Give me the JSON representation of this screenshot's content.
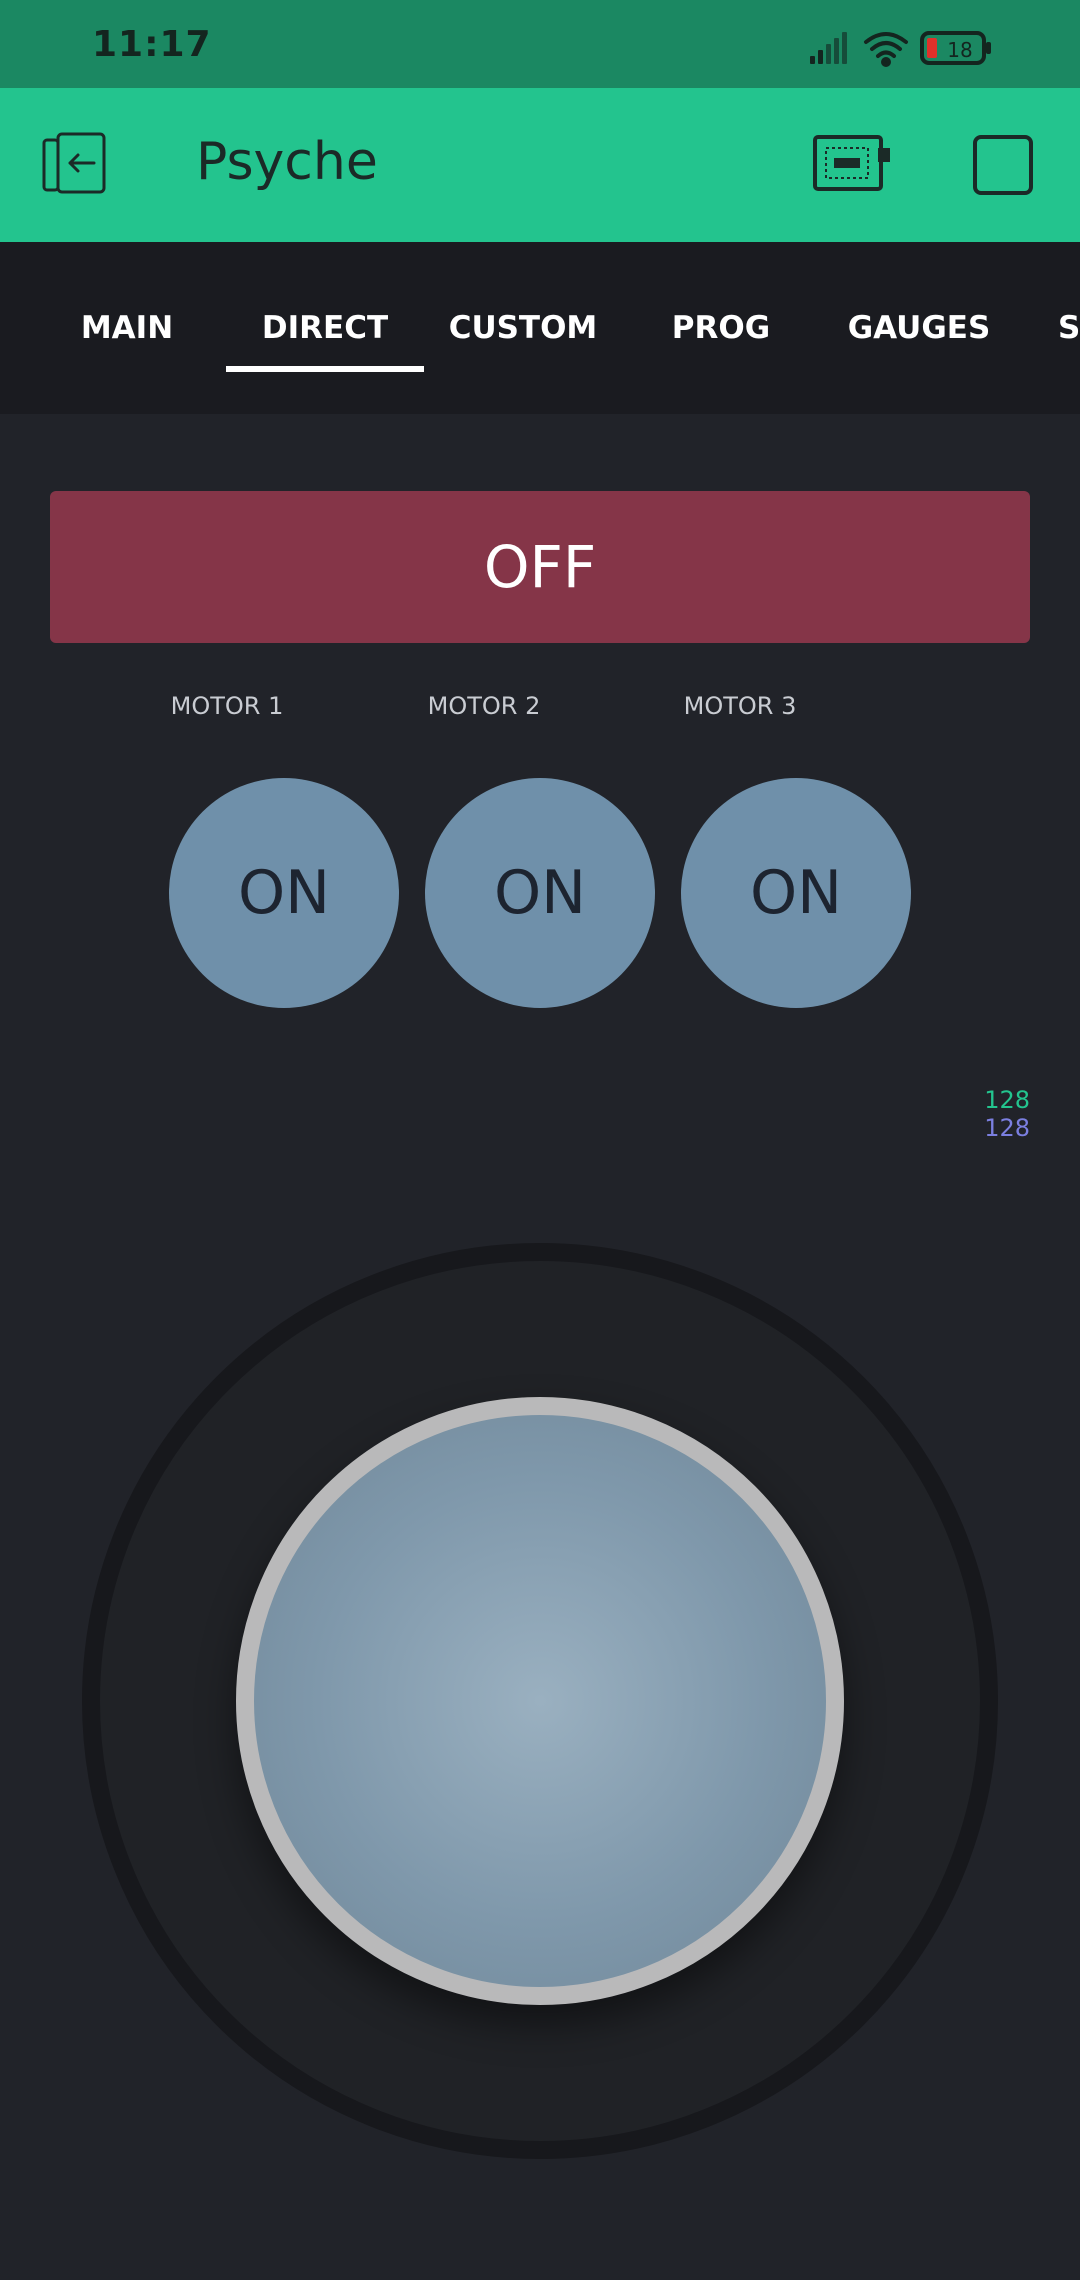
{
  "status_bar": {
    "time": "11:17",
    "battery": "18",
    "icons": [
      "signal-icon",
      "wifi-icon",
      "battery-icon"
    ]
  },
  "app_bar": {
    "title": "Psyche",
    "icons": [
      "exit-icon",
      "device-icon",
      "stop-icon"
    ]
  },
  "tabs": [
    {
      "label": "MAIN"
    },
    {
      "label": "DIRECT",
      "selected": true
    },
    {
      "label": "CUSTOM"
    },
    {
      "label": "PROG"
    },
    {
      "label": "GAUGES"
    },
    {
      "label": "SE"
    }
  ],
  "main": {
    "power_button": "OFF",
    "motors": [
      {
        "label": "MOTOR 1",
        "button": "ON"
      },
      {
        "label": "MOTOR 2",
        "button": "ON"
      },
      {
        "label": "MOTOR 3",
        "button": "ON"
      }
    ],
    "joystick": {
      "x_value": "128",
      "y_value": "128",
      "x_color": "#23c48e",
      "y_color": "#7b7fe0"
    }
  },
  "colors": {
    "status_bar": "#1b8862",
    "app_bar": "#23c48e",
    "tab_bar": "#1a1b20",
    "background": "#212329",
    "off_button": "#853548",
    "motor_button": "#6f90aa"
  }
}
